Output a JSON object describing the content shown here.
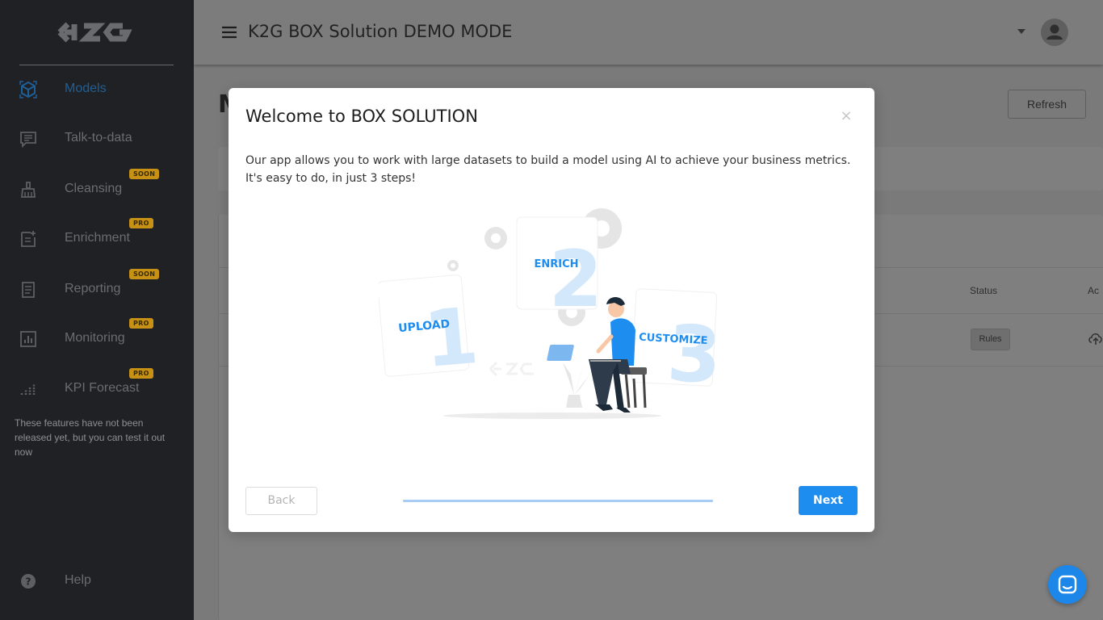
{
  "header": {
    "title": "K2G BOX Solution DEMO MODE"
  },
  "sidebar": {
    "logo_text": "K2G",
    "items": [
      {
        "label": "Models",
        "icon": "cube-icon",
        "badge": ""
      },
      {
        "label": "Talk-to-data",
        "icon": "chat-list-icon",
        "badge": ""
      },
      {
        "label": "Cleansing",
        "icon": "broom-icon",
        "badge": "SOON"
      },
      {
        "label": "Enrichment",
        "icon": "document-plus-icon",
        "badge": "PRO"
      },
      {
        "label": "Reporting",
        "icon": "report-icon",
        "badge": "SOON"
      },
      {
        "label": "Monitoring",
        "icon": "bar-chart-icon",
        "badge": "PRO"
      },
      {
        "label": "KPI Forecast",
        "icon": "forecast-icon",
        "badge": "PRO"
      }
    ],
    "note": "These features have not been released yet, but you can test it out now",
    "help_label": "Help"
  },
  "page": {
    "title": "M",
    "refresh_label": "Refresh",
    "table": {
      "columns": [
        "Status",
        "Ac"
      ],
      "rows": [
        {
          "status": "Rules"
        }
      ]
    }
  },
  "modal": {
    "title": "Welcome to BOX SOLUTION",
    "text_line1": "Our app allows you to work with large datasets to build a model using AI to achieve your business metrics.",
    "text_line2": "It's easy to do, in just 3 steps!",
    "steps": [
      "UPLOAD",
      "ENRICH",
      "CUSTOMIZE"
    ],
    "step_numbers": [
      "1",
      "2",
      "3"
    ],
    "back_label": "Back",
    "next_label": "Next",
    "progress": 1.0
  },
  "colors": {
    "sidebar_bg": "#202124",
    "accent": "#1e8df0",
    "badge": "#c79116"
  }
}
